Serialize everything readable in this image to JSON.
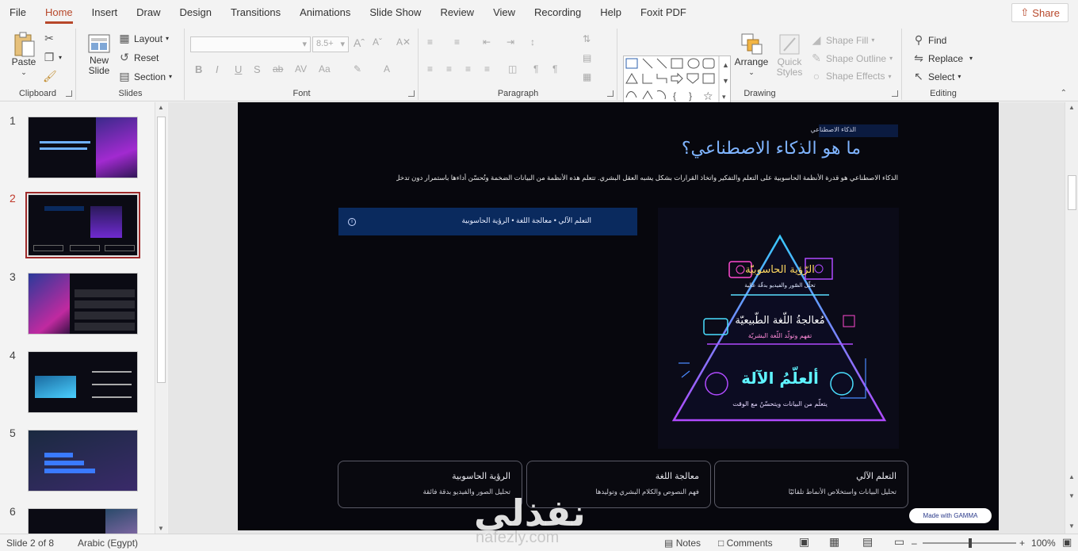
{
  "menu": {
    "tabs": [
      "File",
      "Home",
      "Insert",
      "Draw",
      "Design",
      "Transitions",
      "Animations",
      "Slide Show",
      "Review",
      "View",
      "Recording",
      "Help",
      "Foxit PDF"
    ],
    "active": "Home",
    "share_label": "Share"
  },
  "ribbon": {
    "clipboard": {
      "label": "Clipboard",
      "paste": "Paste"
    },
    "slides": {
      "label": "Slides",
      "new_slide_line1": "New",
      "new_slide_line2": "Slide",
      "layout": "Layout",
      "reset": "Reset",
      "section": "Section"
    },
    "font": {
      "label": "Font",
      "size_value": "8.5+"
    },
    "paragraph": {
      "label": "Paragraph"
    },
    "drawing": {
      "label": "Drawing",
      "arrange": "Arrange",
      "quick_styles_line1": "Quick",
      "quick_styles_line2": "Styles",
      "shape_fill": "Shape Fill",
      "shape_outline": "Shape Outline",
      "shape_effects": "Shape Effects"
    },
    "editing": {
      "label": "Editing",
      "find": "Find",
      "replace": "Replace",
      "select": "Select"
    }
  },
  "thumbnails": [
    {
      "number": "1"
    },
    {
      "number": "2",
      "active": true
    },
    {
      "number": "3"
    },
    {
      "number": "4"
    },
    {
      "number": "5"
    },
    {
      "number": "6"
    }
  ],
  "slide": {
    "top_label": "الذكاء الاصطناعي",
    "title": "ما هو الذكاء الاصطناعي؟",
    "description": "الذكاء الاصطناعي هو قدرة الأنظمة الحاسوبية على التعلم والتفكير واتخاذ القرارات بشكل يشبه العقل البشري. تتعلم هذه الأنظمة من البيانات الضخمة وتُحسّن أداءها باستمرار دون تدخل بشري مباشر.",
    "bar_text": "التعلم الآلي  •  معالجة اللغة  •  الرؤية الحاسوبية",
    "info_icon": "i",
    "pyramid": {
      "top_title": "الرّؤية الحاسوبيّة",
      "top_sub": "تحلّل الصّور والفيديو بدقّة عالية",
      "mid_title": "مُعالجةُ اللّغة الطّبيعيّة",
      "mid_sub": "تفهم وتولّد اللّغة البشريّة",
      "base_title": "ألعلّمُ الآلة",
      "base_sub": "يتعلّم من البيانات ويتحسّنُ مع الوقت"
    },
    "cards": [
      {
        "title": "التعلم الآلي",
        "desc": "تحليل البيانات واستخلاص الأنماط تلقائيًا"
      },
      {
        "title": "معالجة اللغة",
        "desc": "فهم النصوص والكلام البشري وتوليدها"
      },
      {
        "title": "الرؤية الحاسوبية",
        "desc": "تحليل الصور والفيديو بدقة فائقة"
      }
    ],
    "gamma_badge": "Made with GAMMA"
  },
  "status": {
    "slide_indicator": "Slide 2 of 8",
    "language": "Arabic (Egypt)",
    "notes": "Notes",
    "comments": "Comments",
    "zoom": "100%"
  },
  "watermark": {
    "main": "نفذلي",
    "sub": "nafezly.com"
  }
}
